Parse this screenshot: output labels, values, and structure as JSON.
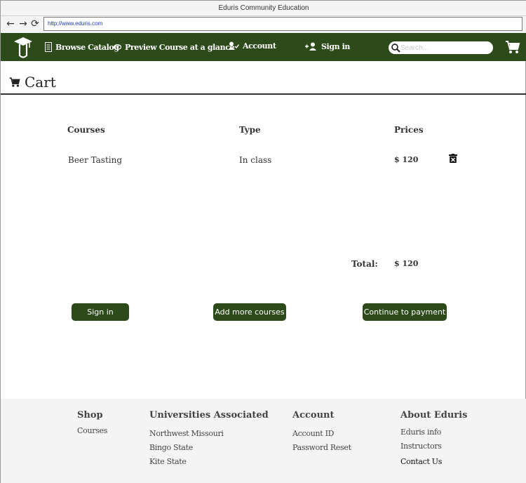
{
  "window": {
    "title": "Eduris Community Education",
    "url": "http://www.eduris.com"
  },
  "browser_controls": {
    "back": "←",
    "forward": "→",
    "reload": "⟳"
  },
  "navbar": {
    "browse_label": "Browse Catalog",
    "preview_label": "Preview Course at a glance",
    "account_label": "Account",
    "signin_label": "Sign in",
    "search_placeholder": "Search...",
    "brand_color": "#2d4a1b"
  },
  "page": {
    "title": "Cart"
  },
  "cart": {
    "headers": {
      "courses": "Courses",
      "type": "Type",
      "prices": "Prices"
    },
    "items": [
      {
        "course": "Beer Tasting",
        "type": "In class",
        "price": "$ 120"
      }
    ],
    "total_label": "Total:",
    "total_value": "$ 120"
  },
  "buttons": {
    "signin": "Sign in",
    "add_more": "Add more courses",
    "continue": "Continue to payment"
  },
  "footer": {
    "shop": {
      "title": "Shop",
      "links": [
        "Courses"
      ]
    },
    "universities": {
      "title": "Universities Associated",
      "links": [
        "Northwest Missouri",
        "Bingo State",
        "Kite State"
      ]
    },
    "account": {
      "title": "Account",
      "links": [
        "Account ID",
        "Password Reset"
      ]
    },
    "about": {
      "title": "About Eduris",
      "links": [
        "Eduris info",
        "Instructors",
        "Contact Us"
      ]
    }
  }
}
